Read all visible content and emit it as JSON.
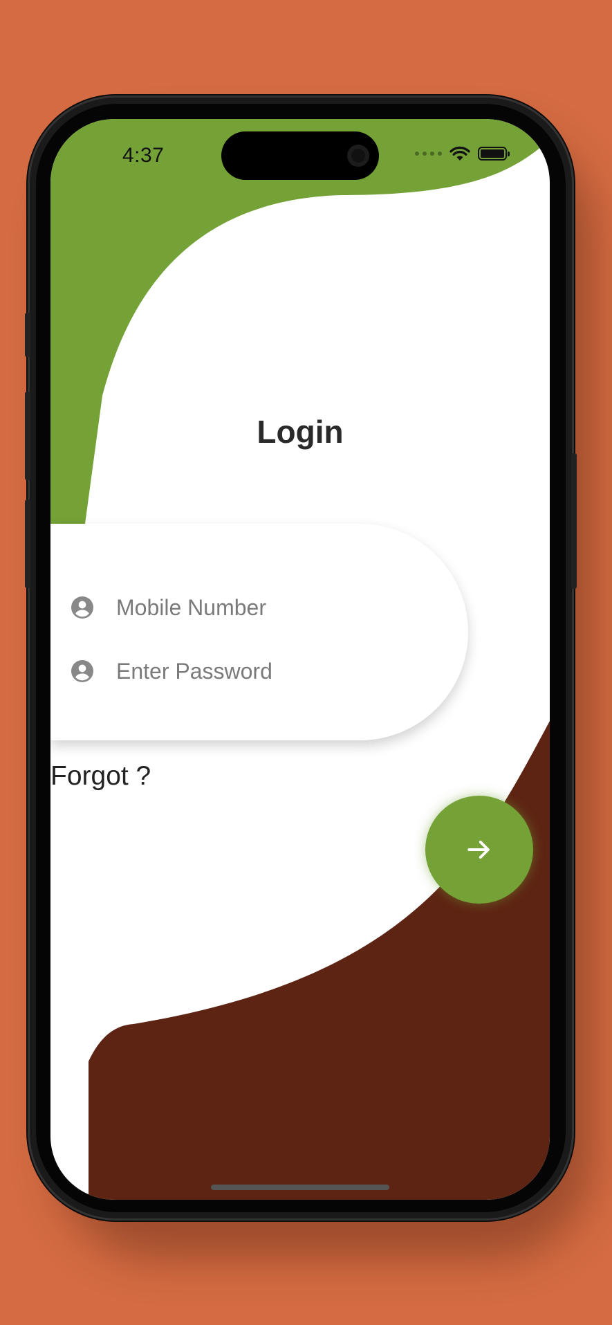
{
  "status_bar": {
    "time": "4:37",
    "icons": [
      "signal-dots-icon",
      "wifi-icon",
      "battery-icon"
    ],
    "battery_level": 1.0
  },
  "login": {
    "title": "Login",
    "mobile_placeholder": "Mobile Number",
    "password_placeholder": "Enter Password",
    "field_icon": "account-circle-icon",
    "forgot_label": "Forgot ?",
    "submit_icon": "arrow-right-icon"
  },
  "colors": {
    "background": "#D46B42",
    "accent_green": "#74A236",
    "accent_brown": "#5E2413",
    "surface": "#FFFFFF",
    "text_primary": "#2A2A2A",
    "text_placeholder": "#7A7A7A"
  }
}
